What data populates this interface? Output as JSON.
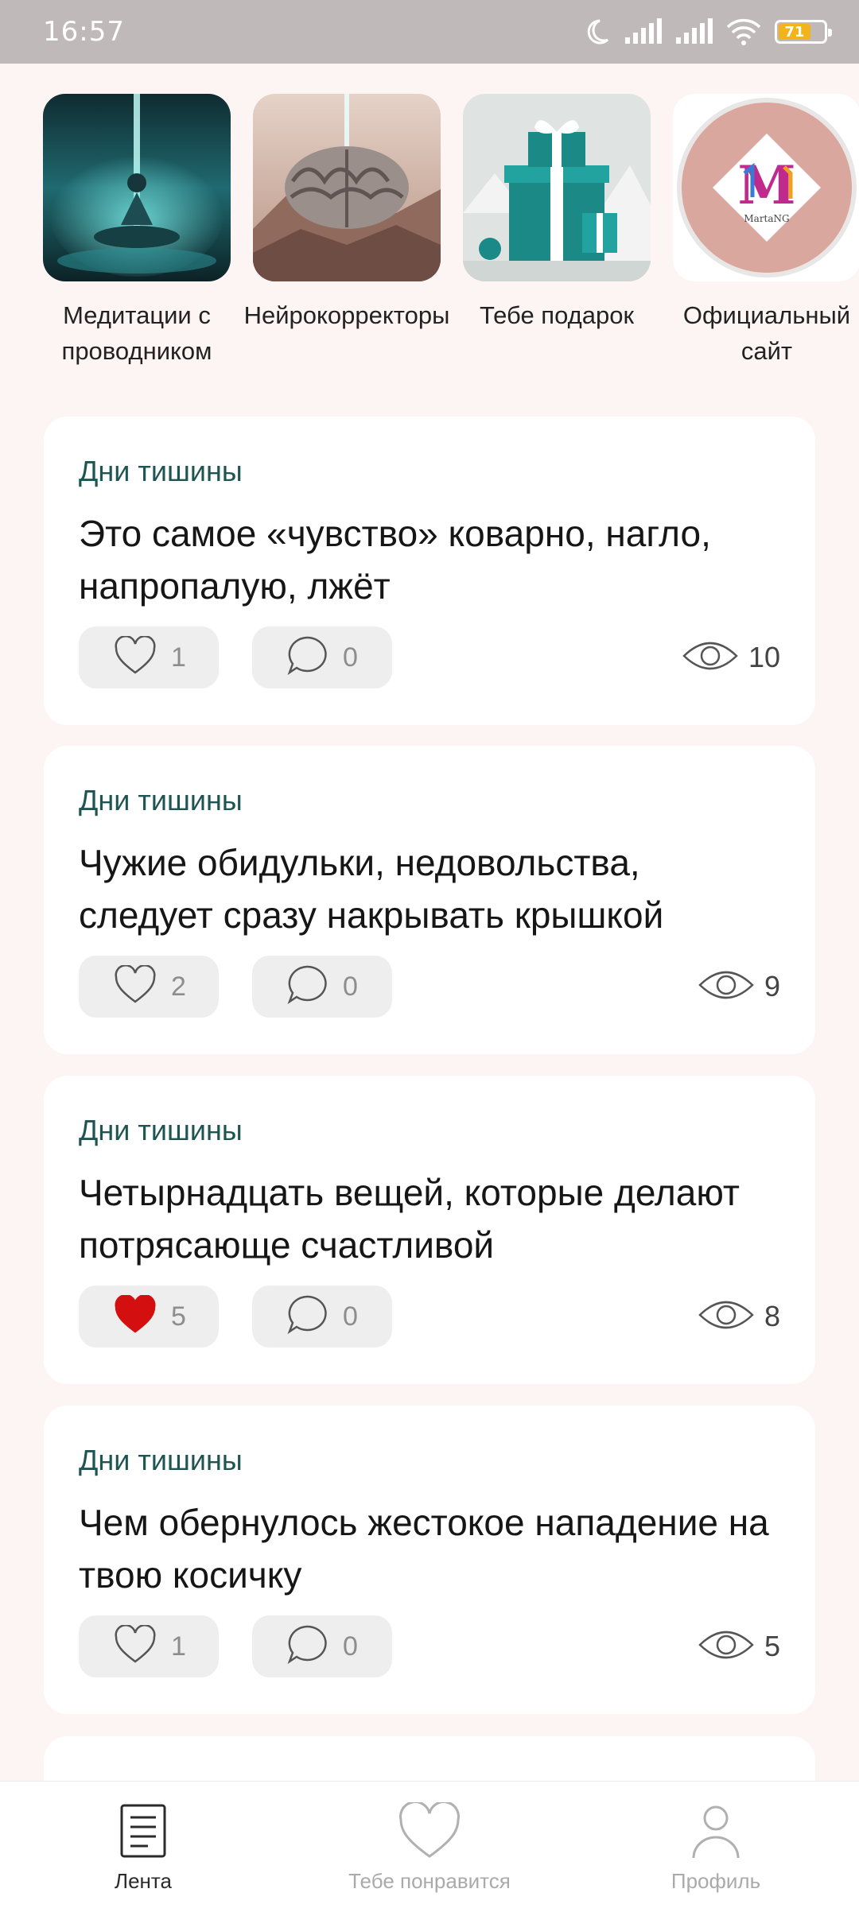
{
  "status_bar": {
    "time": "16:57",
    "battery_level": "71",
    "icons": [
      "moon-icon",
      "signal-icon",
      "signal-icon",
      "wifi-icon",
      "battery-icon"
    ]
  },
  "stories": [
    {
      "label": "Медитации с проводником",
      "image": "meditation-image"
    },
    {
      "label": "Нейрокорректоры",
      "image": "brain-image"
    },
    {
      "label": "Тебе подарок",
      "image": "gift-image"
    },
    {
      "label": "Официальный сайт",
      "image": "martang-logo",
      "logo_text": "MartaNG"
    }
  ],
  "feed": [
    {
      "tag": "Дни тишины",
      "title": "Это самое «чувство» коварно, нагло, напропалую, лжёт",
      "likes": "1",
      "liked": false,
      "comments": "0",
      "views": "10"
    },
    {
      "tag": "Дни тишины",
      "title": "Чужие обидульки, недовольства, следует сразу накрывать крышкой",
      "likes": "2",
      "liked": false,
      "comments": "0",
      "views": "9"
    },
    {
      "tag": "Дни тишины",
      "title": "Четырнадцать вещей, которые делают потрясающе счастливой",
      "likes": "5",
      "liked": true,
      "comments": "0",
      "views": "8"
    },
    {
      "tag": "Дни тишины",
      "title": "Чем обернулось жестокое нападение на твою косичку",
      "likes": "1",
      "liked": false,
      "comments": "0",
      "views": "5"
    }
  ],
  "bottom_nav": [
    {
      "label": "Лента",
      "icon": "feed-icon",
      "active": true
    },
    {
      "label": "Тебе понравится",
      "icon": "heart-icon",
      "active": false
    },
    {
      "label": "Профиль",
      "icon": "profile-icon",
      "active": false
    }
  ],
  "colors": {
    "background": "#fdf5f3",
    "accent": "#1e5552",
    "liked": "#d40f0f",
    "status_bar": "#bfb9b9"
  }
}
